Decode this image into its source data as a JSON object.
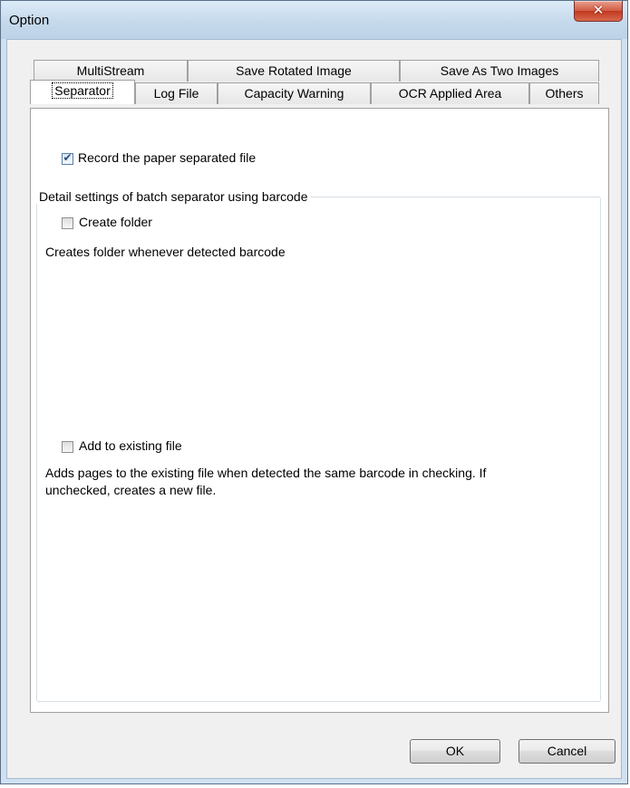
{
  "window": {
    "title": "Option",
    "close_glyph": "✕"
  },
  "tabs": {
    "row1": [
      "MultiStream",
      "Save Rotated Image",
      "Save As Two Images"
    ],
    "row2": [
      "Separator",
      "Log File",
      "Capacity Warning",
      "OCR Applied Area",
      "Others"
    ],
    "active": "Separator"
  },
  "separator": {
    "record_checkbox": {
      "label": "Record the paper separated file",
      "checked": true
    },
    "group_title": "Detail settings of batch separator using barcode",
    "create_folder": {
      "label": "Create folder",
      "checked": false,
      "description": "Creates folder whenever detected barcode"
    },
    "add_existing": {
      "label": "Add to existing file",
      "checked": false,
      "description": "Adds pages to the existing file when detected the same barcode in checking. If unchecked, creates a new file."
    }
  },
  "buttons": {
    "ok": "OK",
    "cancel": "Cancel"
  },
  "icons": {
    "checkmark": "✔"
  }
}
